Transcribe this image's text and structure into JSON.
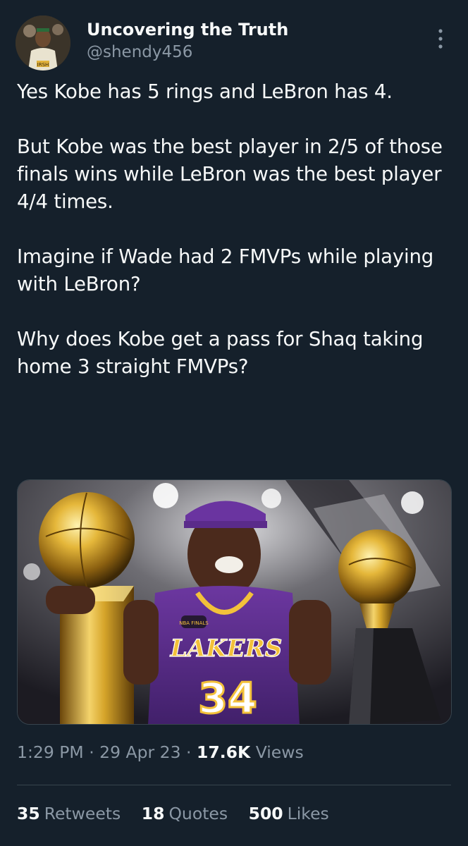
{
  "author": {
    "display_name": "Uncovering the Truth",
    "handle": "@shendy456"
  },
  "tweet": {
    "paragraphs": [
      "Yes Kobe has 5 rings and LeBron has 4.",
      "But Kobe was the best player in 2/5 of those finals wins while LeBron was the best player 4/4 times.",
      "Imagine if Wade had 2 FMVPs while playing with LeBron?",
      "Why does Kobe get a pass for Shaq taking home 3 straight FMVPs?"
    ],
    "media": {
      "jersey_text": "LAKERS",
      "jersey_number": "34",
      "badge_text": "NBA FINALS"
    }
  },
  "meta": {
    "time": "1:29 PM",
    "separator": "·",
    "date": "29 Apr 23",
    "views_count": "17.6K",
    "views_label": "Views"
  },
  "stats": {
    "retweets_count": "35",
    "retweets_label": "Retweets",
    "quotes_count": "18",
    "quotes_label": "Quotes",
    "likes_count": "500",
    "likes_label": "Likes"
  },
  "colors": {
    "background": "#15202b",
    "primary_text": "#f7f9f9",
    "secondary_text": "#8b98a5",
    "divider": "#38444d",
    "lakers_purple": "#5b2a86",
    "lakers_gold": "#f3c13a"
  }
}
